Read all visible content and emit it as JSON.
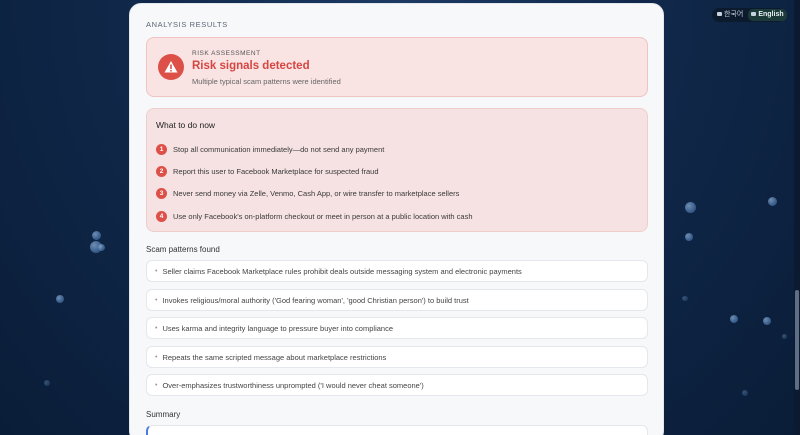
{
  "language_switch": {
    "korean_label": "한국어",
    "english_label": "English",
    "active": "English"
  },
  "results": {
    "section_label": "ANALYSIS RESULTS",
    "risk": {
      "kicker": "RISK ASSESSMENT",
      "title": "Risk signals detected",
      "subtitle": "Multiple typical scam patterns were identified",
      "accent_color": "#dd5048"
    },
    "todo": {
      "title": "What to do now",
      "steps": [
        {
          "num": "1",
          "text": "Stop all communication immediately—do not send any payment"
        },
        {
          "num": "2",
          "text": "Report this user to Facebook Marketplace for suspected fraud"
        },
        {
          "num": "3",
          "text": "Never send money via Zelle, Venmo, Cash App, or wire transfer to marketplace sellers"
        },
        {
          "num": "4",
          "text": "Use only Facebook's on-platform checkout or meet in person at a public location with cash"
        }
      ]
    },
    "patterns": {
      "title": "Scam patterns found",
      "items": [
        "Seller claims Facebook Marketplace rules prohibit deals outside messaging system and electronic payments",
        "Invokes religious/moral authority ('God fearing woman', 'good Christian person') to build trust",
        "Uses karma and integrity language to pressure buyer into compliance",
        "Repeats the same scripted message about marketplace restrictions",
        "Over-emphasizes trustworthiness unprompted ('I would never cheat someone')"
      ]
    },
    "summary": {
      "title": "Summary"
    }
  }
}
